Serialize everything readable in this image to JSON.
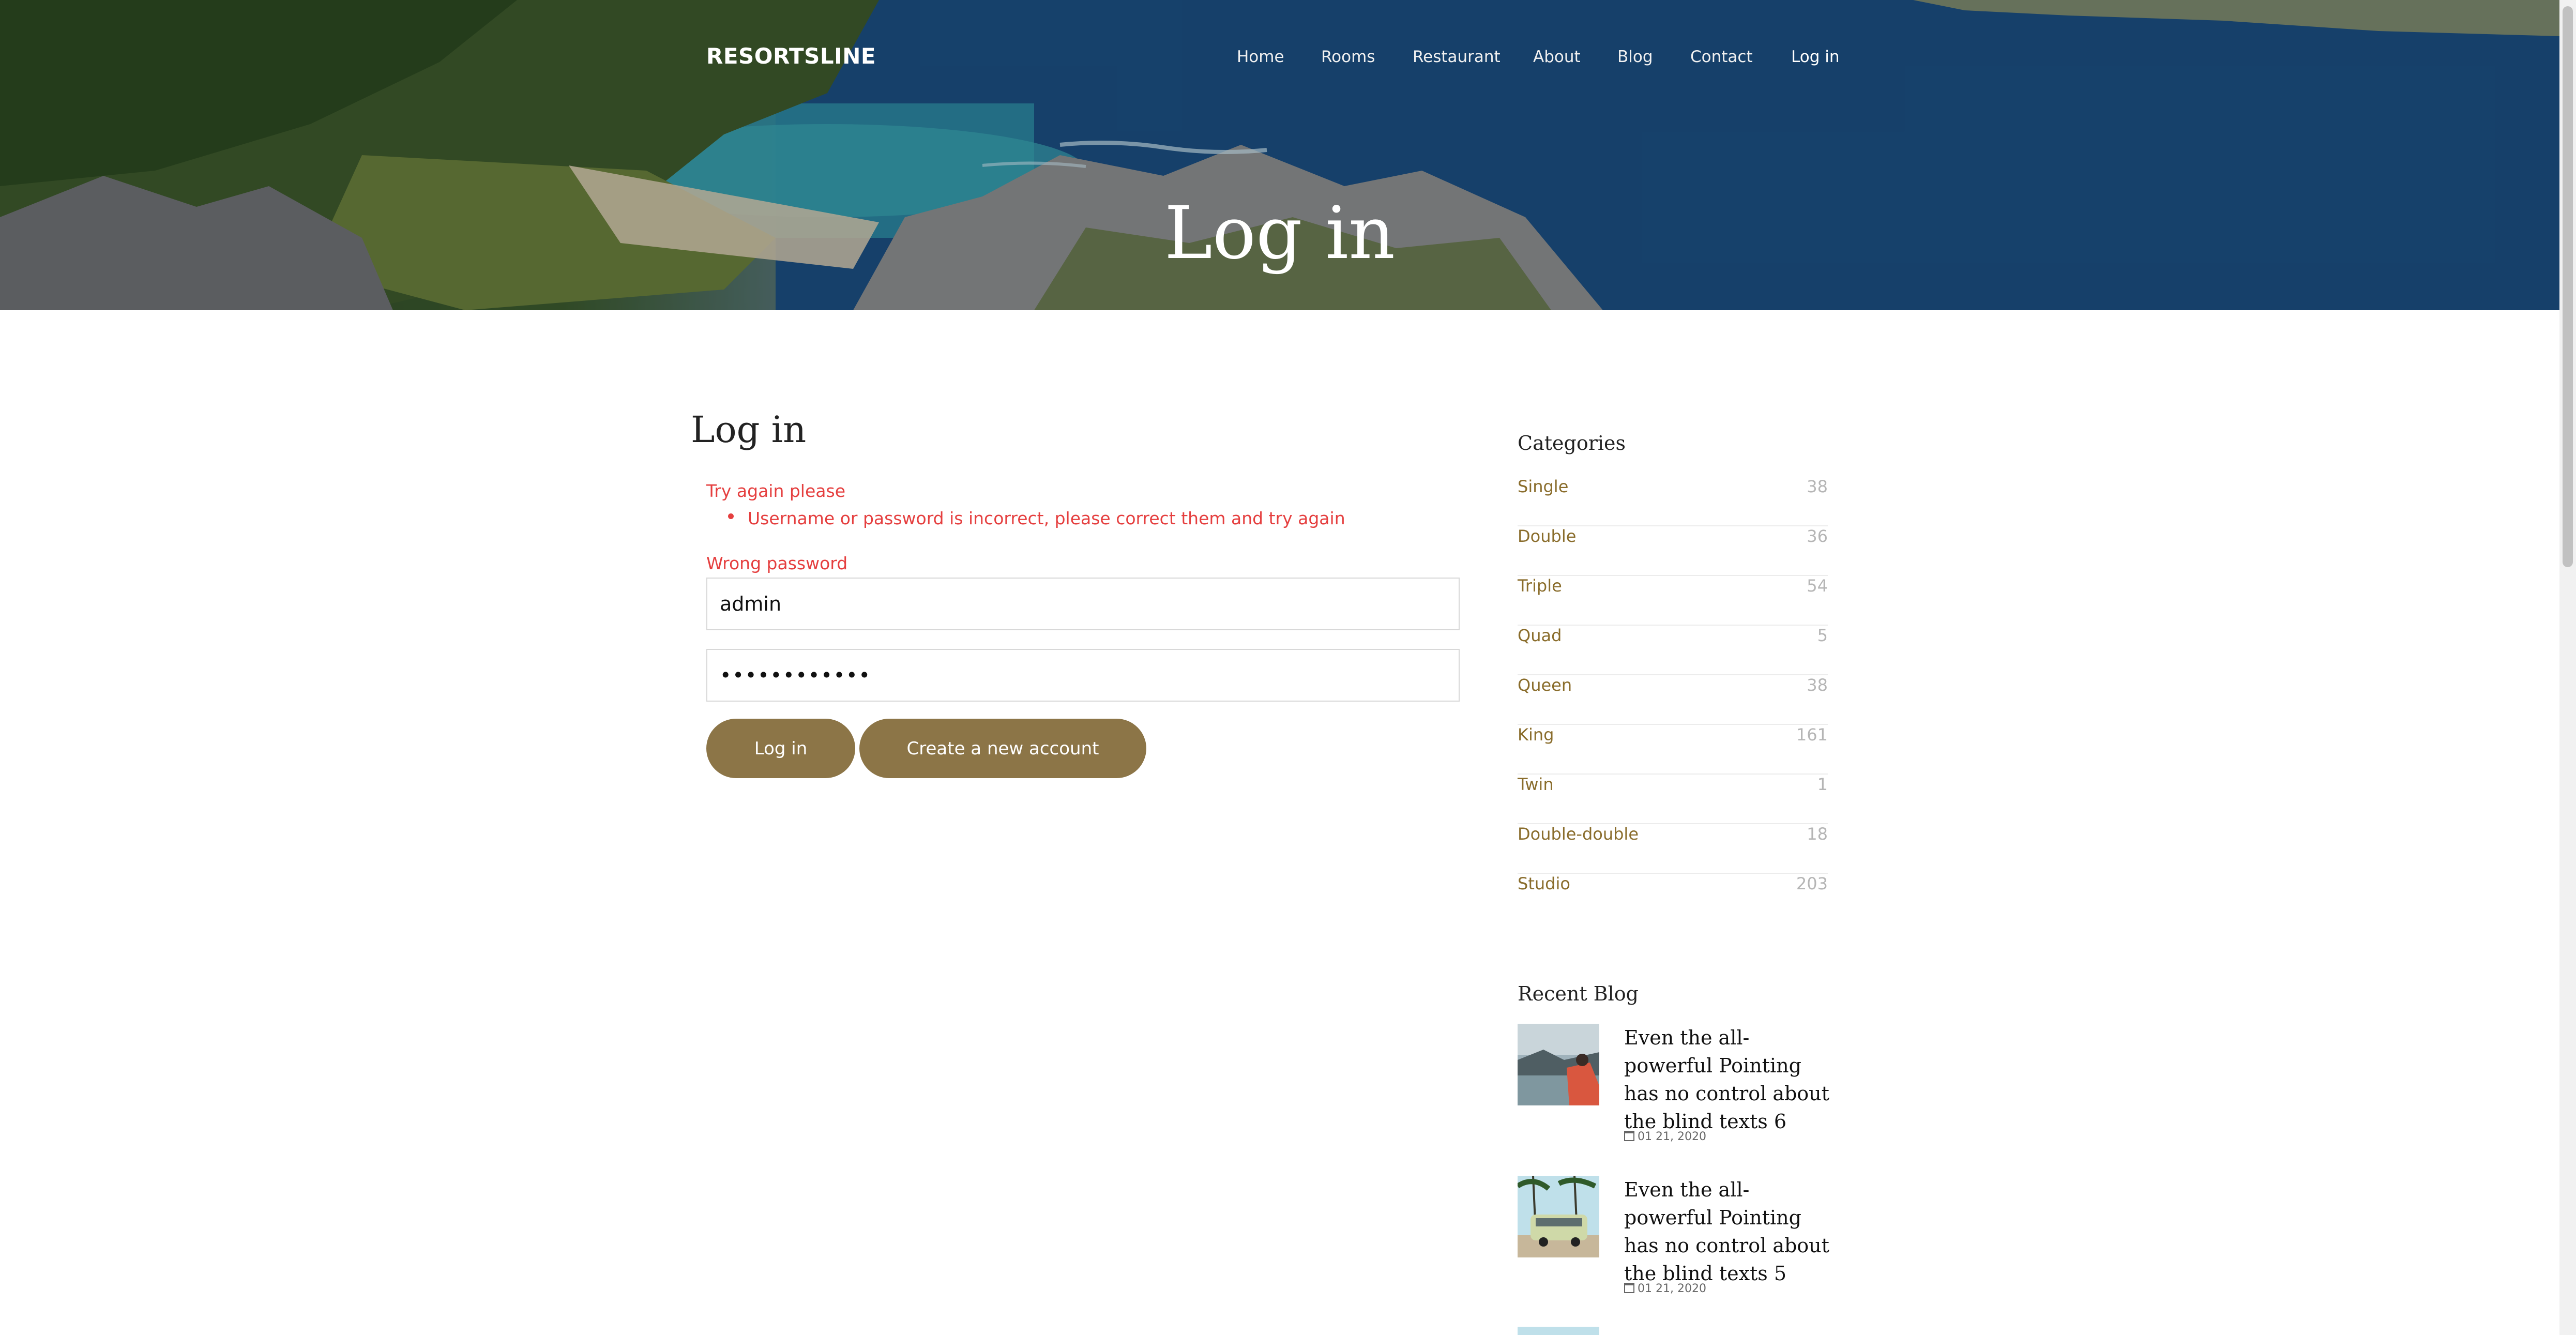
{
  "header": {
    "brand": "RESORTSLINE",
    "nav": [
      "Home",
      "Rooms",
      "Restaurant",
      "About",
      "Blog",
      "Contact",
      "Log in"
    ],
    "active_nav": "Log in",
    "hero_title": "Log in"
  },
  "login": {
    "heading": "Log in",
    "error_title": "Try again please",
    "error_item": "Username or password is incorrect, please correct them and try again",
    "field_error": "Wrong password",
    "username_value": "admin",
    "password_value": "••••••••••••",
    "login_button": "Log in",
    "create_button": "Create a new account"
  },
  "sidebar": {
    "categories_heading": "Categories",
    "categories": [
      {
        "name": "Single",
        "count": "38"
      },
      {
        "name": "Double",
        "count": "36"
      },
      {
        "name": "Triple",
        "count": "54"
      },
      {
        "name": "Quad",
        "count": "5"
      },
      {
        "name": "Queen",
        "count": "38"
      },
      {
        "name": "King",
        "count": "161"
      },
      {
        "name": "Twin",
        "count": "1"
      },
      {
        "name": "Double-double",
        "count": "18"
      },
      {
        "name": "Studio",
        "count": "203"
      }
    ],
    "recent_heading": "Recent Blog",
    "posts": [
      {
        "title": "Even the all-powerful Pointing has no control about the blind texts 6",
        "date": "01 21, 2020"
      },
      {
        "title": "Even the all-powerful Pointing has no control about the blind texts 5",
        "date": "01 21, 2020"
      }
    ]
  },
  "colors": {
    "accent": "#8c7547",
    "error": "#e53f3f",
    "category_text": "#8a6d2c"
  },
  "icons": {
    "calendar": "calendar-icon"
  }
}
